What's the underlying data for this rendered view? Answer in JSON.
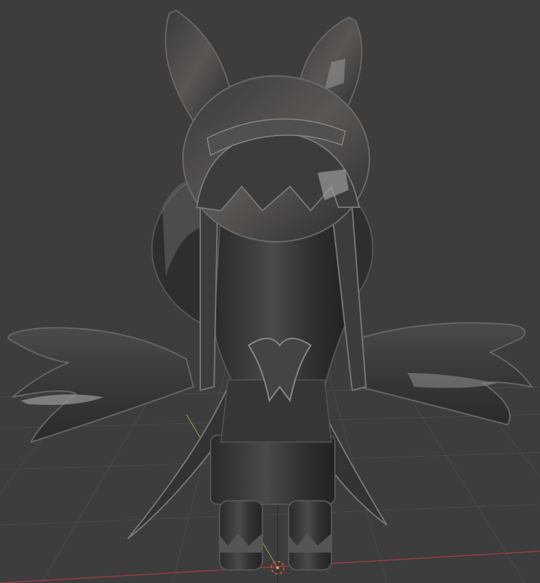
{
  "viewport": {
    "view": "3D viewport",
    "shading_mode": "solid",
    "background_color": "#3d3d3d",
    "grid_color": "#4a4a4a",
    "x_axis_color": "#9b3b45",
    "y_axis_color": "#7fa13a",
    "z_axis_color": "#3a66a8",
    "cursor_color": "#c85050"
  },
  "scene": {
    "object": {
      "kind": "mesh",
      "description_icon": "character-mesh-icon",
      "base_color": "#3a3a3a",
      "highlight_color": "#8a8a8a"
    },
    "origin_marker": "origin-point-icon",
    "cursor": "3d-cursor-icon"
  }
}
